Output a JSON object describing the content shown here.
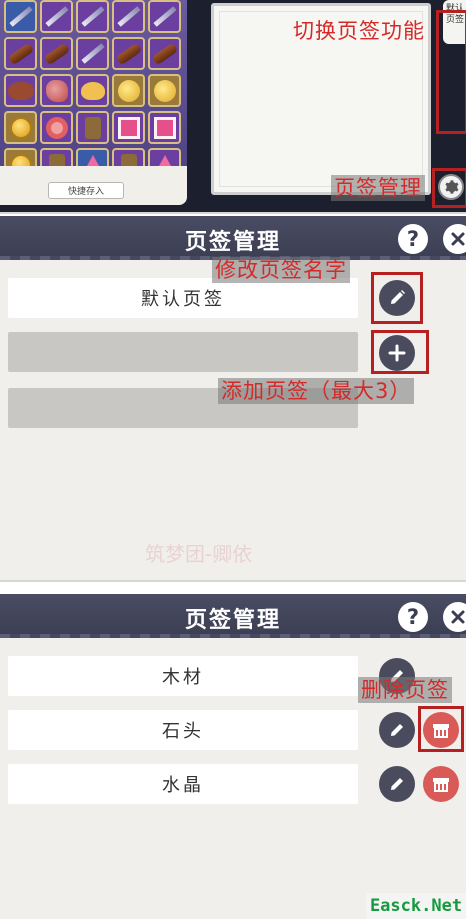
{
  "top": {
    "inventory": {
      "quick_store_label": "快捷存入",
      "slots": [
        {
          "icon": "sword-icon",
          "style": "blue"
        },
        {
          "icon": "bow-icon",
          "style": "purple"
        },
        {
          "icon": "staff-icon",
          "style": "purple"
        },
        {
          "icon": "staff-icon",
          "style": "purple"
        },
        {
          "icon": "staff-icon",
          "style": "purple"
        },
        {
          "icon": "cannon-icon",
          "style": "purple"
        },
        {
          "icon": "gun-icon",
          "style": "purple"
        },
        {
          "icon": "blaster-icon",
          "style": "purple"
        },
        {
          "icon": "log-icon",
          "style": "purple"
        },
        {
          "icon": "log-icon",
          "style": "purple"
        },
        {
          "icon": "beast-icon",
          "style": "purple"
        },
        {
          "icon": "rock-icon",
          "style": "purple"
        },
        {
          "icon": "cloud-icon",
          "style": "purple"
        },
        {
          "icon": "moon-coin-icon",
          "style": "gold"
        },
        {
          "icon": "moon-coin-icon",
          "style": "gold"
        },
        {
          "icon": "coin-icon",
          "style": "gold"
        },
        {
          "icon": "ring-icon",
          "style": "purple"
        },
        {
          "icon": "robot-icon",
          "style": "purple"
        },
        {
          "icon": "gift-icon",
          "style": "purple"
        },
        {
          "icon": "gift-icon",
          "style": "purple"
        },
        {
          "icon": "coin-icon",
          "style": "gold"
        },
        {
          "icon": "book-icon",
          "style": "purple"
        },
        {
          "icon": "star-icon",
          "style": "blue"
        },
        {
          "icon": "figure-icon",
          "style": "purple"
        },
        {
          "icon": "flower-icon",
          "style": "purple"
        }
      ]
    },
    "side_tab_label": "默认页签",
    "anno_switch": "切换页签功能",
    "anno_manage": "页签管理"
  },
  "panel1": {
    "title": "页签管理",
    "help_label": "?",
    "rows": [
      {
        "label": "默认页签"
      },
      {
        "label": ""
      },
      {
        "label": ""
      }
    ],
    "anno_rename": "修改页签名字",
    "anno_add": "添加页签（最大3）",
    "watermark": "筑梦团-卿依"
  },
  "panel2": {
    "title": "页签管理",
    "help_label": "?",
    "rows": [
      {
        "label": "木材"
      },
      {
        "label": "石头"
      },
      {
        "label": "水晶"
      }
    ],
    "anno_delete": "删除页签"
  },
  "site_watermark": "Easck.Net",
  "colors": {
    "header": "#3b3d52",
    "panel_bg": "#f0efeb",
    "annotation_red": "#d42a2a",
    "edit_button": "#4a4c5e",
    "delete_button": "#d95a56"
  }
}
